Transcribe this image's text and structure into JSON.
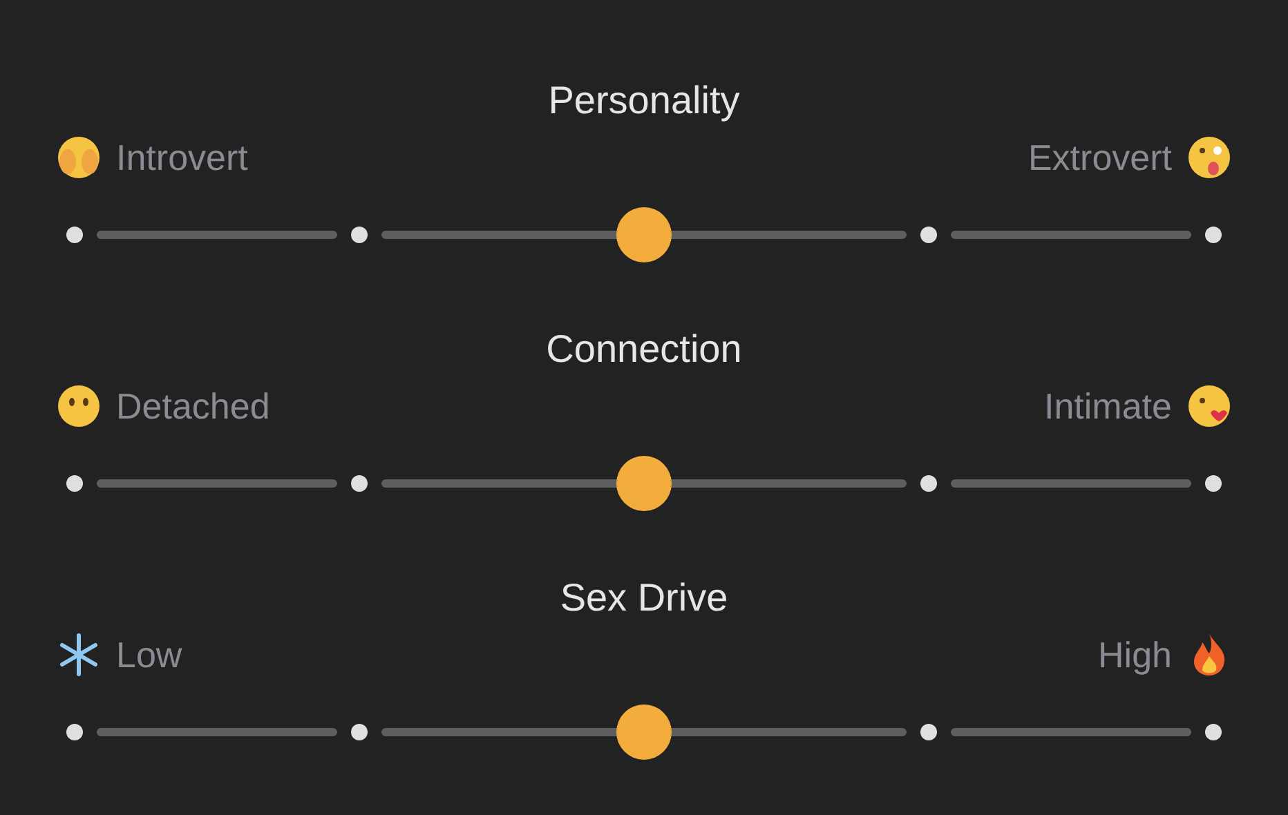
{
  "sliders": [
    {
      "title": "Personality",
      "low_label": "Introvert",
      "high_label": "Extrovert",
      "level": 0.5
    },
    {
      "title": "Connection",
      "low_label": "Detached",
      "high_label": "Intimate",
      "level": 0.5
    },
    {
      "title": "Sex Drive",
      "low_label": "Low",
      "high_label": "High",
      "level": 0.5
    }
  ]
}
